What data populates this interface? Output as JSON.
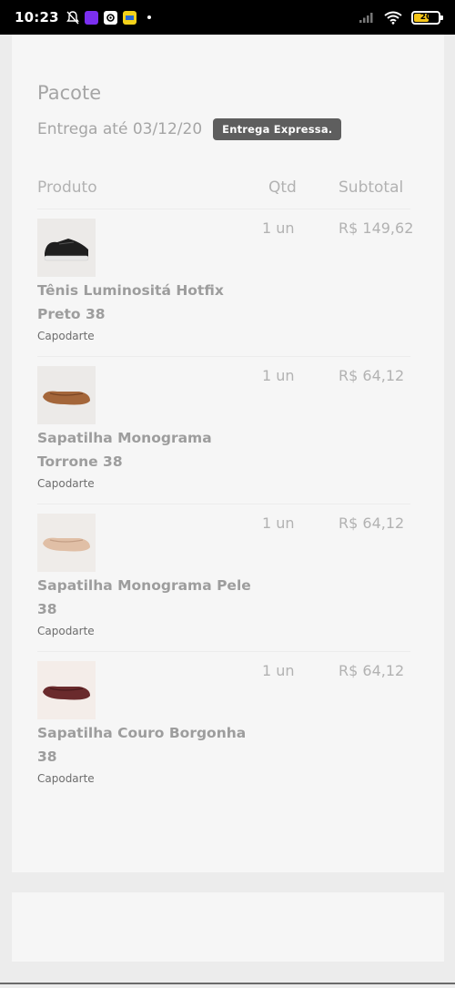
{
  "status_bar": {
    "time": "10:23",
    "icons": [
      "notification-off-icon",
      "app-icon-purple",
      "app-icon-settings",
      "app-icon-yellow"
    ],
    "battery_level": "20",
    "colors": {
      "background": "#000000",
      "battery": "#f5c518"
    }
  },
  "package": {
    "title": "Pacote",
    "delivery_text": "Entrega até 03/12/20",
    "badge": "Entrega Expressa."
  },
  "columns": {
    "product": "Produto",
    "qty": "Qtd",
    "subtotal": "Subtotal"
  },
  "items": [
    {
      "name": "Tênis Luminositá Hotfix Preto 38",
      "brand": "Capodarte",
      "qty": "1 un",
      "subtotal": "R$ 149,62",
      "image": "black-sneaker",
      "color": "#1f1f1f"
    },
    {
      "name": "Sapatilha Monograma Torrone 38",
      "brand": "Capodarte",
      "qty": "1 un",
      "subtotal": "R$ 64,12",
      "image": "brown-flat",
      "color": "#a4663a"
    },
    {
      "name": "Sapatilha Monograma Pele 38",
      "brand": "Capodarte",
      "qty": "1 un",
      "subtotal": "R$ 64,12",
      "image": "nude-flat",
      "color": "#e0bfa6"
    },
    {
      "name": "Sapatilha Couro Borgonha 38",
      "brand": "Capodarte",
      "qty": "1 un",
      "subtotal": "R$ 64,12",
      "image": "burgundy-flat",
      "color": "#6a2a2c"
    }
  ],
  "colors": {
    "badge": "#5e5e5e",
    "card": "#f6f6f6",
    "background": "#ececec"
  }
}
